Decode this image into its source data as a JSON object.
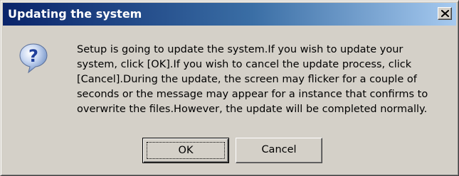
{
  "dialog": {
    "title": "Updating the system",
    "close_icon": "close-icon",
    "message_icon": "question-icon",
    "message_lines": [
      "Setup is going to update the system.If you wish to update your",
      "system, click [OK].If you wish to cancel the update process, click",
      "[Cancel].During the update, the screen may flicker for a couple of",
      "seconds or the message may appear for a instance that confirms to",
      "overwrite the files.However, the update will be completed normally."
    ],
    "buttons": {
      "ok_label": "OK",
      "cancel_label": "Cancel"
    }
  },
  "colors": {
    "titlebar_start": "#0a246a",
    "titlebar_end": "#a6caf0",
    "face": "#d4d0c8"
  }
}
